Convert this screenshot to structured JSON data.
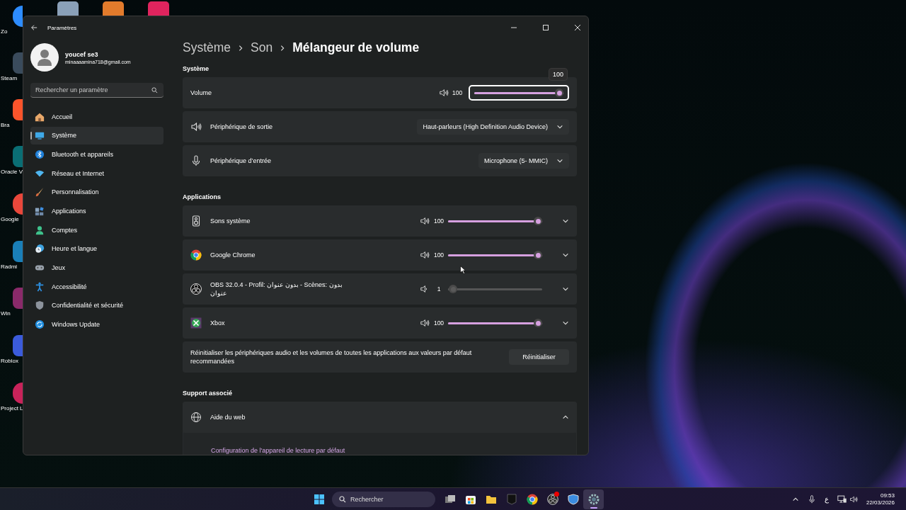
{
  "desktop": {
    "icons": [
      {
        "label": "Zo"
      },
      {
        "label": "Steam"
      },
      {
        "label": "Bra"
      },
      {
        "label": "Oracle Vi"
      },
      {
        "label": "Google"
      },
      {
        "label": "Radmi"
      },
      {
        "label": "Win"
      },
      {
        "label": "Roblox"
      },
      {
        "label": "Project L"
      }
    ]
  },
  "window": {
    "title": "Paramètres"
  },
  "profile": {
    "name": "youcef se3",
    "email": "minaaaamina718@gmail.com"
  },
  "search": {
    "placeholder": "Rechercher un paramètre"
  },
  "sidebar": {
    "items": [
      {
        "label": "Accueil",
        "selected": false
      },
      {
        "label": "Système",
        "selected": true
      },
      {
        "label": "Bluetooth et appareils",
        "selected": false
      },
      {
        "label": "Réseau et Internet",
        "selected": false
      },
      {
        "label": "Personnalisation",
        "selected": false
      },
      {
        "label": "Applications",
        "selected": false
      },
      {
        "label": "Comptes",
        "selected": false
      },
      {
        "label": "Heure et langue",
        "selected": false
      },
      {
        "label": "Jeux",
        "selected": false
      },
      {
        "label": "Accessibilité",
        "selected": false
      },
      {
        "label": "Confidentialité et sécurité",
        "selected": false
      },
      {
        "label": "Windows Update",
        "selected": false
      }
    ]
  },
  "breadcrumb": [
    "Système",
    "Son",
    "Mélangeur de volume"
  ],
  "system": {
    "title": "Système",
    "volume": {
      "label": "Volume",
      "reading": "100",
      "level": 1.0,
      "tooltip": "100"
    },
    "devices": [
      {
        "label": "Périphérique de sortie",
        "value": "Haut-parleurs (High Definition Audio Device)"
      },
      {
        "label": "Périphérique d’entrée",
        "value": "Microphone (5- MMIC)"
      }
    ]
  },
  "applications": {
    "title": "Applications",
    "apps": [
      {
        "name": "Sons système",
        "reading": "100",
        "level": 1.0,
        "disabled": false,
        "expanded": false
      },
      {
        "name": "Google Chrome",
        "reading": "100",
        "level": 1.0,
        "disabled": false,
        "expanded": false
      },
      {
        "name": "OBS 32.0.4 - Profil: بدون عنوان - Scènes: بدون عنوان",
        "reading": "1",
        "level": 0.01,
        "disabled": true,
        "expanded": false
      },
      {
        "name": "Xbox",
        "reading": "100",
        "level": 1.0,
        "disabled": false,
        "expanded": false
      }
    ],
    "reset": {
      "text": "Réinitialiser les périphériques audio et les volumes de toutes les applications aux valeurs par défaut recommandées",
      "button": "Réinitialiser"
    }
  },
  "support": {
    "title": "Support associé",
    "items": [
      {
        "label": "Aide du web",
        "expanded": true,
        "links": [
          "Configuration de l'appareil de lecture par défaut"
        ]
      }
    ]
  },
  "taskbar": {
    "search": {
      "placeholder": "Rechercher"
    },
    "apps": [
      {
        "active": false,
        "badge": false
      },
      {
        "active": false,
        "badge": false
      },
      {
        "active": false,
        "badge": false
      },
      {
        "active": false,
        "badge": false
      },
      {
        "active": false,
        "badge": false
      },
      {
        "active": false,
        "badge": true
      },
      {
        "active": false,
        "badge": false
      },
      {
        "active": true,
        "badge": false
      }
    ],
    "keyboard": "ع",
    "time": "09:53",
    "date": "22/03/2026"
  }
}
